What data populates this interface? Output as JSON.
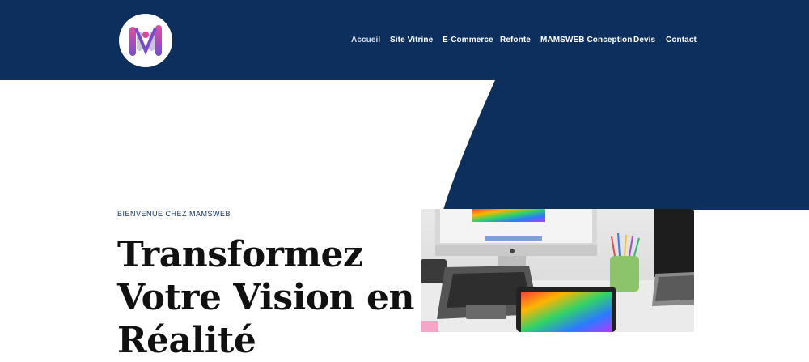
{
  "header": {
    "logo": {
      "icon": "mamsweb-logo-icon"
    },
    "nav": [
      {
        "label": "Accueil",
        "active": true
      },
      {
        "label": "Site Vitrine"
      },
      {
        "label": "E-Commerce"
      },
      {
        "label": "Refonte"
      },
      {
        "label": "MAMSWEB Conception"
      },
      {
        "label": "Devis"
      },
      {
        "label": "Contact"
      }
    ]
  },
  "hero": {
    "eyebrow": "BIENVENUE CHEZ MAMSWEB",
    "headline_lines": [
      "Transformez",
      "Votre Vision en",
      "Réalité"
    ],
    "image": {
      "icon": "desk-computers-photo"
    }
  },
  "colors": {
    "header_bg": "#0d2f5e",
    "accent_pink": "#d9479c",
    "accent_purple": "#7a4bd1",
    "heading": "#111111"
  }
}
